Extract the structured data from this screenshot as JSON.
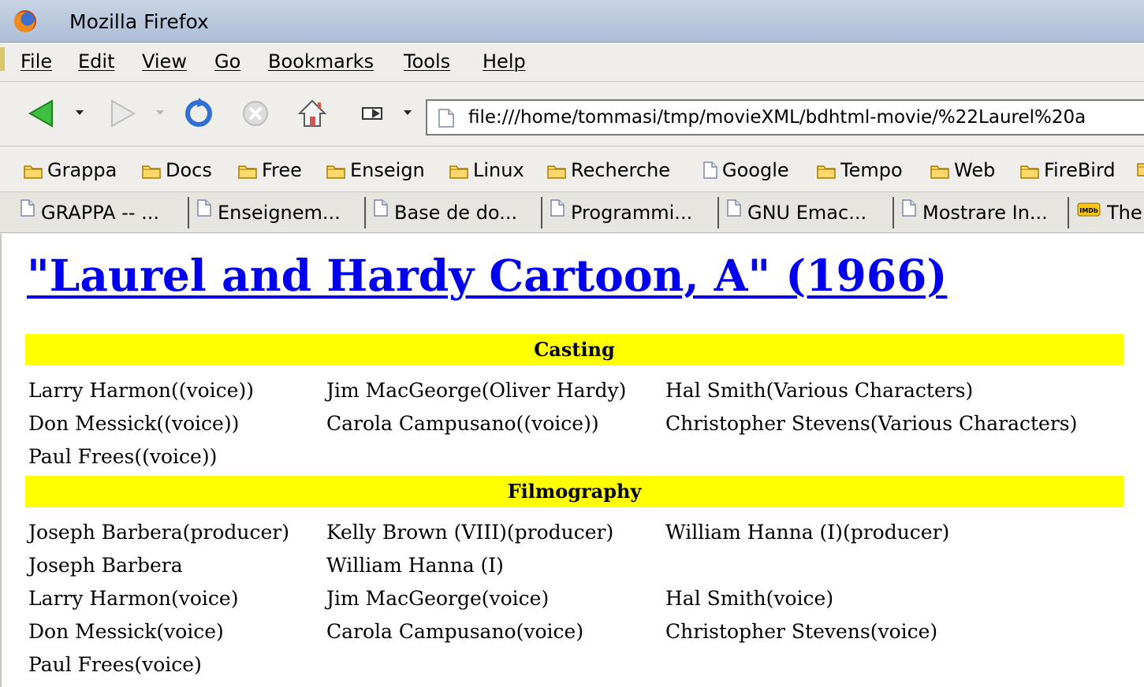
{
  "window": {
    "title": "Mozilla Firefox"
  },
  "menu": [
    "File",
    "Edit",
    "View",
    "Go",
    "Bookmarks",
    "Tools",
    "Help"
  ],
  "navigation": {
    "url": "file:///home/tommasi/tmp/movieXML/bdhtml-movie/%22Laurel%20a"
  },
  "bookmarks": [
    {
      "label": "Grappa",
      "icon": "folder-icon"
    },
    {
      "label": "Docs",
      "icon": "folder-icon"
    },
    {
      "label": "Free",
      "icon": "folder-icon"
    },
    {
      "label": "Enseign",
      "icon": "folder-icon"
    },
    {
      "label": "Linux",
      "icon": "folder-icon"
    },
    {
      "label": "Recherche",
      "icon": "folder-icon"
    },
    {
      "label": "Google",
      "icon": "page-icon"
    },
    {
      "label": "Tempo",
      "icon": "folder-icon"
    },
    {
      "label": "Web",
      "icon": "folder-icon"
    },
    {
      "label": "FireBird",
      "icon": "folder-icon"
    }
  ],
  "tabs": [
    {
      "label": "GRAPPA -- ...",
      "icon": "page-icon"
    },
    {
      "label": "Enseignem...",
      "icon": "page-icon"
    },
    {
      "label": "Base de do...",
      "icon": "page-icon"
    },
    {
      "label": "Programmi...",
      "icon": "page-icon"
    },
    {
      "label": "GNU Emac...",
      "icon": "page-icon"
    },
    {
      "label": "Mostrare In...",
      "icon": "page-icon"
    },
    {
      "label": "The",
      "icon": "imdb-icon"
    }
  ],
  "page": {
    "title": "\"Laurel and Hardy Cartoon, A\" (1966)",
    "casting": {
      "header": "Casting",
      "rows": [
        [
          "Larry Harmon((voice))",
          "Jim MacGeorge(Oliver Hardy)",
          "Hal Smith(Various Characters)"
        ],
        [
          "Don Messick((voice))",
          "Carola Campusano((voice))",
          "Christopher Stevens(Various Characters)"
        ],
        [
          "Paul Frees((voice))",
          "",
          ""
        ]
      ]
    },
    "filmography": {
      "header": "Filmography",
      "rows": [
        [
          "Joseph Barbera(producer)",
          "Kelly Brown (VIII)(producer)",
          "William Hanna (I)(producer)"
        ],
        [
          "Joseph Barbera",
          "William Hanna (I)",
          ""
        ],
        [
          "Larry Harmon(voice)",
          "Jim MacGeorge(voice)",
          "Hal Smith(voice)"
        ],
        [
          "Don Messick(voice)",
          "Carola Campusano(voice)",
          "Christopher Stevens(voice)"
        ],
        [
          "Paul Frees(voice)",
          "",
          ""
        ]
      ]
    }
  },
  "colors": {
    "link": "#0000ee",
    "section_header_bg": "#ffff00",
    "toolbar_bg": "#efeeea"
  }
}
